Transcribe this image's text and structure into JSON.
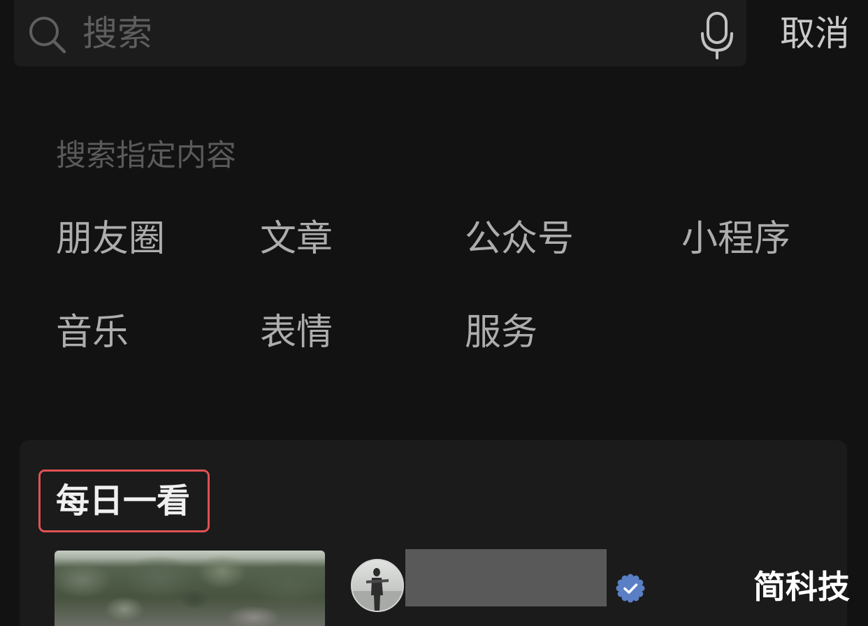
{
  "search": {
    "placeholder": "搜索",
    "search_icon": "search-icon",
    "voice_icon": "microphone-icon"
  },
  "header": {
    "cancel_label": "取消"
  },
  "search_targets": {
    "title": "搜索指定内容",
    "items": [
      {
        "label": "朋友圈"
      },
      {
        "label": "文章"
      },
      {
        "label": "公众号"
      },
      {
        "label": "小程序"
      },
      {
        "label": "音乐"
      },
      {
        "label": "表情"
      },
      {
        "label": "服务"
      }
    ]
  },
  "daily_card": {
    "title": "每日一看",
    "highlight_color": "#e05252",
    "verified_icon": "verified-badge-icon",
    "verified_color": "#5a7fc4"
  },
  "watermark": {
    "text": "简科技"
  },
  "theme": {
    "page_background": "#121212",
    "search_bar_background": "#1c1c1c",
    "card_background": "#1b1b1b"
  }
}
